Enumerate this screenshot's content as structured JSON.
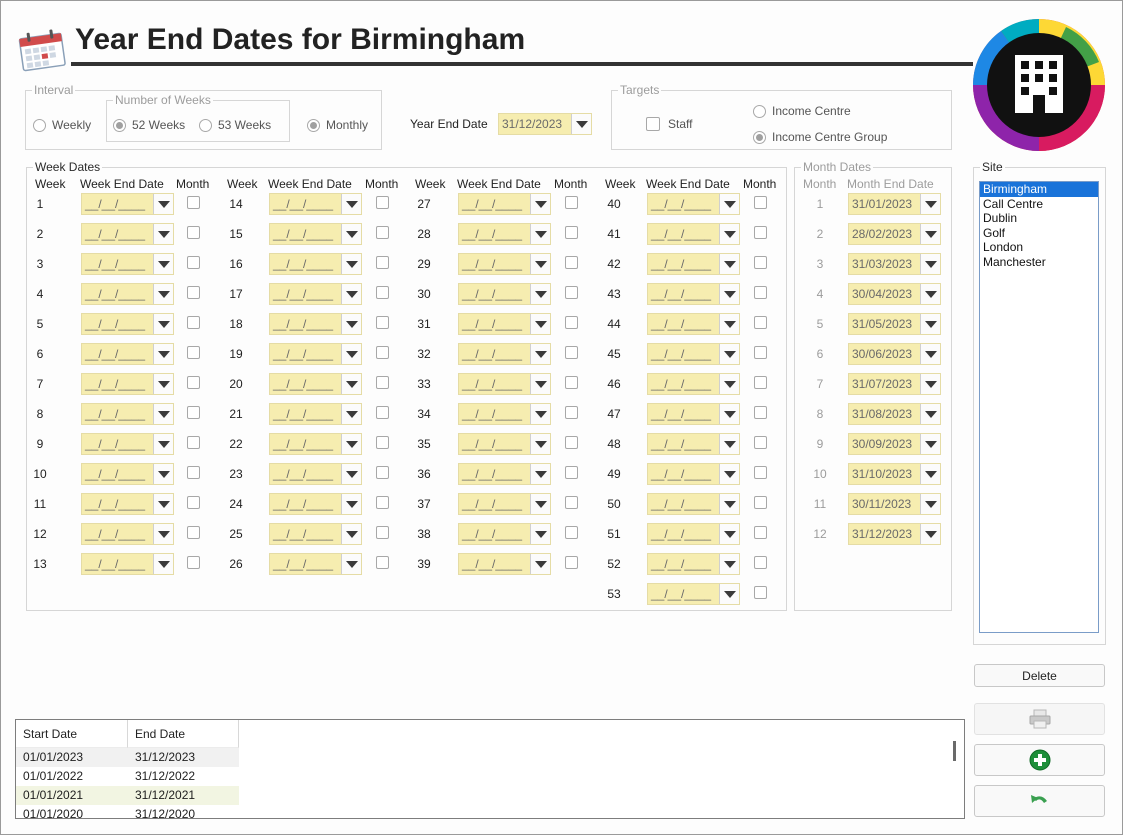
{
  "header": {
    "title": "Year End Dates for Birmingham",
    "calendar_icon": "calendar-icon",
    "logo_icon": "building-logo-icon"
  },
  "interval": {
    "caption": "Interval",
    "weekly": "Weekly",
    "number_of_weeks_caption": "Number of Weeks",
    "weeks52": "52 Weeks",
    "weeks53": "53 Weeks",
    "monthly": "Monthly",
    "selected": "52 Weeks"
  },
  "year_end": {
    "label": "Year End Date",
    "value": "31/12/2023"
  },
  "targets": {
    "caption": "Targets",
    "staff": "Staff",
    "income_centre": "Income Centre",
    "income_centre_group": "Income Centre Group",
    "selected": "Income Centre Group"
  },
  "week_dates": {
    "caption": "Week Dates",
    "col_week": "Week",
    "col_end_date": "Week End Date",
    "col_month": "Month",
    "empty_mask": "__/__/____",
    "weeks": [
      "1",
      "2",
      "3",
      "4",
      "5",
      "6",
      "7",
      "8",
      "9",
      "10",
      "11",
      "12",
      "13",
      "14",
      "15",
      "16",
      "17",
      "18",
      "19",
      "20",
      "21",
      "22",
      "23",
      "24",
      "25",
      "26",
      "27",
      "28",
      "29",
      "30",
      "31",
      "32",
      "33",
      "34",
      "35",
      "36",
      "37",
      "38",
      "39",
      "40",
      "41",
      "42",
      "43",
      "44",
      "45",
      "46",
      "47",
      "48",
      "49",
      "50",
      "51",
      "52",
      "53"
    ]
  },
  "month_dates": {
    "caption": "Month Dates",
    "col_month": "Month",
    "col_end_date": "Month End Date",
    "rows": [
      {
        "month": "1",
        "date": "31/01/2023"
      },
      {
        "month": "2",
        "date": "28/02/2023"
      },
      {
        "month": "3",
        "date": "31/03/2023"
      },
      {
        "month": "4",
        "date": "30/04/2023"
      },
      {
        "month": "5",
        "date": "31/05/2023"
      },
      {
        "month": "6",
        "date": "30/06/2023"
      },
      {
        "month": "7",
        "date": "31/07/2023"
      },
      {
        "month": "8",
        "date": "31/08/2023"
      },
      {
        "month": "9",
        "date": "30/09/2023"
      },
      {
        "month": "10",
        "date": "31/10/2023"
      },
      {
        "month": "11",
        "date": "30/11/2023"
      },
      {
        "month": "12",
        "date": "31/12/2023"
      }
    ]
  },
  "site": {
    "caption": "Site",
    "items": [
      "Birmingham",
      "Call Centre",
      "Dublin",
      "Golf",
      "London",
      "Manchester"
    ],
    "selected": "Birmingham"
  },
  "buttons": {
    "delete": "Delete",
    "print_icon": "printer-icon",
    "add_icon": "add-icon",
    "undo_icon": "undo-icon"
  },
  "history": {
    "columns": [
      "Start Date",
      "End Date"
    ],
    "rows": [
      {
        "start": "01/01/2023",
        "end": "31/12/2023"
      },
      {
        "start": "01/01/2022",
        "end": "31/12/2022"
      },
      {
        "start": "01/01/2021",
        "end": "31/12/2021"
      },
      {
        "start": "01/01/2020",
        "end": "31/12/2020"
      }
    ]
  },
  "colors": {
    "date_field": "#f6edb0",
    "selection": "#1a73d9",
    "add_green": "#1e8f3a"
  }
}
